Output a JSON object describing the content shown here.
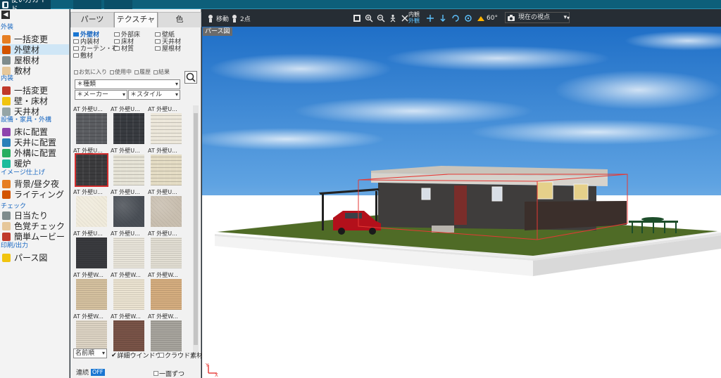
{
  "topbar": {
    "guide_label": "使い方ガイド"
  },
  "sidebar": {
    "collapse_icon": "◀",
    "sections": [
      {
        "heading": "外装",
        "items": [
          "一括変更",
          "外壁材",
          "屋根材",
          "敷材"
        ]
      },
      {
        "heading": "内装",
        "items": [
          "一括変更",
          "壁・床材",
          "天井材"
        ]
      },
      {
        "heading": "設備・家具・外構",
        "items": [
          "床に配置",
          "天井に配置",
          "外構に配置",
          "暖炉"
        ]
      },
      {
        "heading": "イメージ仕上げ",
        "items": [
          "背景/昼夕夜",
          "ライティング"
        ]
      },
      {
        "heading": "チェック",
        "items": [
          "日当たり",
          "色覚チェック",
          "簡単ムービー"
        ]
      },
      {
        "heading": "印刷/出力",
        "items": [
          "パース図"
        ]
      }
    ],
    "active_item": "外壁材"
  },
  "panel": {
    "tabs": [
      "パーツ",
      "テクスチャ",
      "色"
    ],
    "active_tab": "テクスチャ",
    "categories": [
      "外壁材",
      "外部床",
      "壁紙",
      "内装材",
      "床材",
      "天井材",
      "カーテン・布",
      "材質",
      "屋根材",
      "敷材"
    ],
    "active_category": "外壁材",
    "filters": [
      "お気に入り",
      "使用中",
      "履歴",
      "結果"
    ],
    "type_select": "＊種類",
    "maker_select": "＊メーカー",
    "style_select": "＊スタイル",
    "swatches": [
      {
        "label": "AT 外壁U...",
        "color": "#5b5d61",
        "pattern": "brick"
      },
      {
        "label": "AT 外壁U...",
        "color": "#383b40",
        "pattern": "brick"
      },
      {
        "label": "AT 外壁U...",
        "color": "#ece7da",
        "pattern": "brick"
      },
      {
        "label": "AT 外壁U...",
        "color": "#3c3c3e",
        "pattern": "brick",
        "selected": true
      },
      {
        "label": "AT 外壁U...",
        "color": "#e6e3d6",
        "pattern": "brick"
      },
      {
        "label": "AT 外壁U...",
        "color": "#e4dcc4",
        "pattern": "brick"
      },
      {
        "label": "AT 外壁U...",
        "color": "#f0ebdc",
        "pattern": "stucco"
      },
      {
        "label": "AT 外壁U...",
        "color": "#4a4f56",
        "pattern": "stucco"
      },
      {
        "label": "AT 外壁U...",
        "color": "#c9bfb0",
        "pattern": "stucco"
      },
      {
        "label": "AT 外壁U...",
        "color": "#3a3b3f",
        "pattern": "lines"
      },
      {
        "label": "AT 外壁U...",
        "color": "#e9e5da",
        "pattern": "lines"
      },
      {
        "label": "AT 外壁U...",
        "color": "#e3dfd4",
        "pattern": "lines"
      },
      {
        "label": "AT 外壁W...",
        "color": "#d6c2a0",
        "pattern": "lines"
      },
      {
        "label": "AT 外壁W...",
        "color": "#ece4d2",
        "pattern": "lines"
      },
      {
        "label": "AT 外壁W...",
        "color": "#d6ae80",
        "pattern": "lines"
      },
      {
        "label": "AT 外壁W...",
        "color": "#ddd4c4",
        "pattern": "lines"
      },
      {
        "label": "AT 外壁W...",
        "color": "#7a5448",
        "pattern": "lines"
      },
      {
        "label": "AT 外壁W...",
        "color": "#a8a59e",
        "pattern": "lines"
      }
    ],
    "sort_select": "名前順",
    "detail_window_label": "詳細ウインドウ",
    "detail_window_checked": true,
    "cloud_label": "クラウド素材",
    "cloud_checked": false,
    "continuous_label": "連続",
    "continuous_state": "OFF",
    "one_face_label": "一面ずつ"
  },
  "viewport_toolbar": {
    "move_label": "移動",
    "two_point_label": "2点",
    "inner_label": "内観",
    "outer_label": "外観",
    "angle_label": "60°",
    "view_select": "現在の視点"
  },
  "viewport": {
    "title": "パース図",
    "axis_x": "X",
    "axis_y": "Y"
  }
}
